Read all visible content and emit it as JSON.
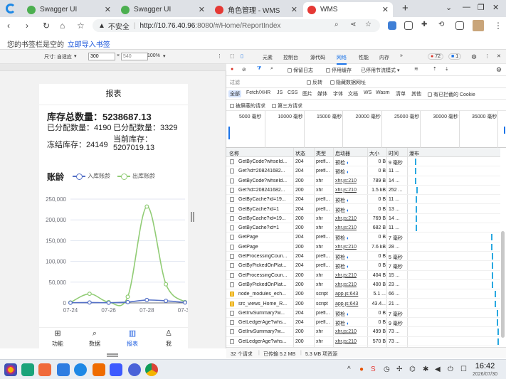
{
  "browser": {
    "tabs": [
      {
        "title": "Swagger UI",
        "color": "#4caf50",
        "active": false
      },
      {
        "title": "Swagger UI",
        "color": "#4caf50",
        "active": false
      },
      {
        "title": "角色管理 - WMS",
        "color": "#e53935",
        "active": false
      },
      {
        "title": "WMS",
        "color": "#e53935",
        "active": true
      }
    ],
    "new_tab": "+",
    "address": {
      "security_label": "不安全",
      "url_host": "http://10.76.40.96",
      "url_rest": ":8080/#/Home/ReportIndex"
    },
    "bookmarks_text": "您的书签栏是空的",
    "bookmarks_link": "立即导入书签"
  },
  "device_toolbar": {
    "size_label": "尺寸: 自适应",
    "width": "300",
    "times": "×",
    "height": "540",
    "zoom": "100%"
  },
  "report": {
    "header": "报表",
    "total_label": "库存总数量：5238687.13",
    "allocated": "已分配数量：4190",
    "allocated2": "已分配数量：3329",
    "frozen": "冻结库存：24149",
    "current_label": "当前库存：",
    "current_value": "5207019.13",
    "aging_title": "账龄",
    "legend_in": "入库账龄",
    "legend_out": "出库账龄"
  },
  "chart_data": {
    "type": "line",
    "categories": [
      "07-24",
      "07-25",
      "07-26",
      "07-27",
      "07-28",
      "07-29",
      "07-30"
    ],
    "x_tick_labels": [
      "07-24",
      "07-26",
      "07-28",
      "07-30"
    ],
    "y_tick_labels": [
      "0",
      "50,000",
      "100,000",
      "150,000",
      "200,000",
      "250,000"
    ],
    "ylim": [
      0,
      250000
    ],
    "series": [
      {
        "name": "入库账龄",
        "color": "#5470c6",
        "values": [
          500,
          1000,
          500,
          2000,
          7000,
          5000,
          1000
        ]
      },
      {
        "name": "出库账龄",
        "color": "#91cc75",
        "values": [
          1000,
          22000,
          2000,
          15000,
          232000,
          45000,
          2000
        ]
      }
    ]
  },
  "bottom_nav": [
    {
      "label": "功能",
      "icon": "⊞"
    },
    {
      "label": "数据",
      "icon": "⌕"
    },
    {
      "label": "报表",
      "icon": "▥",
      "active": true
    },
    {
      "label": "我",
      "icon": "♙"
    }
  ],
  "devtools": {
    "tabs": [
      "元素",
      "控制台",
      "源代码",
      "网络",
      "性能",
      "内存",
      "»"
    ],
    "active_tab": "网络",
    "errors": "72",
    "messages": "1",
    "toolbar": {
      "preserve_log": "保留日志",
      "disable_cache": "停用缓存",
      "throttle": "已停用节流模式"
    },
    "filter_placeholder": "过滤",
    "invert": "反转",
    "hide_data_urls": "隐藏数据网址",
    "type_filters": [
      "全部",
      "Fetch/XHR",
      "JS",
      "CSS",
      "图片",
      "媒体",
      "字体",
      "文档",
      "WS",
      "Wasm",
      "清单",
      "其他"
    ],
    "blocked_cookies": "有已拦截的 Cookie",
    "blocked_requests": "被屏蔽的请求",
    "third_party": "第三方请求",
    "timeline_labels": [
      "5000 毫秒",
      "10000 毫秒",
      "15000 毫秒",
      "20000 毫秒",
      "25000 毫秒",
      "30000 毫秒",
      "35000 毫秒"
    ],
    "columns": [
      "名称",
      "状态",
      "类型",
      "启动器",
      "大小",
      "时间",
      "瀑布"
    ],
    "requests": [
      {
        "name": "GetByCode?whseId...",
        "status": "204",
        "type": "prefl...",
        "initiator": "预检",
        "size": "0 B",
        "time": "9 毫秒"
      },
      {
        "name": "Get?id=208241682...",
        "status": "204",
        "type": "prefl...",
        "initiator": "预检",
        "size": "0 B",
        "time": "11 ..."
      },
      {
        "name": "GetByCode?whseId...",
        "status": "200",
        "type": "xhr",
        "initiator": "xhr.js:210",
        "size": "789 B",
        "time": "14 ..."
      },
      {
        "name": "Get?id=208241682...",
        "status": "200",
        "type": "xhr",
        "initiator": "xhr.js:210",
        "size": "1.5 kB",
        "time": "252 ..."
      },
      {
        "name": "GetByCache?id=19...",
        "status": "204",
        "type": "prefl...",
        "initiator": "预检",
        "size": "0 B",
        "time": "11 ..."
      },
      {
        "name": "GetByCache?id=1",
        "status": "204",
        "type": "prefl...",
        "initiator": "预检",
        "size": "0 B",
        "time": "13 ..."
      },
      {
        "name": "GetByCache?id=19...",
        "status": "200",
        "type": "xhr",
        "initiator": "xhr.js:210",
        "size": "769 B",
        "time": "14 ..."
      },
      {
        "name": "GetByCache?id=1",
        "status": "200",
        "type": "xhr",
        "initiator": "xhr.js:210",
        "size": "682 B",
        "time": "11 ..."
      },
      {
        "name": "GetPage",
        "status": "204",
        "type": "prefl...",
        "initiator": "预检",
        "size": "0 B",
        "time": "7 毫秒"
      },
      {
        "name": "GetPage",
        "status": "200",
        "type": "xhr",
        "initiator": "xhr.js:210",
        "size": "7.6 kB",
        "time": "28 ..."
      },
      {
        "name": "GetProcessingCoun...",
        "status": "204",
        "type": "prefl...",
        "initiator": "预检",
        "size": "0 B",
        "time": "5 毫秒"
      },
      {
        "name": "GetByPickedOnPlat...",
        "status": "204",
        "type": "prefl...",
        "initiator": "预检",
        "size": "0 B",
        "time": "7 毫秒"
      },
      {
        "name": "GetProcessingCoun...",
        "status": "200",
        "type": "xhr",
        "initiator": "xhr.js:210",
        "size": "404 B",
        "time": "15 ..."
      },
      {
        "name": "GetByPickedOnPlat...",
        "status": "200",
        "type": "xhr",
        "initiator": "xhr.js:210",
        "size": "400 B",
        "time": "23 ..."
      },
      {
        "name": "node_modules_ech...",
        "status": "200",
        "type": "script",
        "initiator": "app.js:643",
        "size": "5.1 ...",
        "time": "66 ..."
      },
      {
        "name": "src_views_Home_R...",
        "status": "200",
        "type": "script",
        "initiator": "app.js:643",
        "size": "43.4...",
        "time": "21 ..."
      },
      {
        "name": "GetInvSummary?w...",
        "status": "204",
        "type": "prefl...",
        "initiator": "预检",
        "size": "0 B",
        "time": "7 毫秒"
      },
      {
        "name": "GetLedgerAge?whs...",
        "status": "204",
        "type": "prefl...",
        "initiator": "预检",
        "size": "0 B",
        "time": "9 毫秒"
      },
      {
        "name": "GetInvSummary?w...",
        "status": "200",
        "type": "xhr",
        "initiator": "xhr.js:210",
        "size": "499 B",
        "time": "73 ..."
      },
      {
        "name": "GetLedgerAge?whs...",
        "status": "200",
        "type": "xhr",
        "initiator": "xhr.js:210",
        "size": "570 B",
        "time": "73 ..."
      }
    ],
    "status": {
      "requests": "32 个请求",
      "transferred": "已传输 5.2 MB",
      "resources": "5.3 MB 项资源"
    }
  },
  "taskbar": {
    "time": "16:42",
    "date": "2026/07/30",
    "tray_caret": "^"
  }
}
